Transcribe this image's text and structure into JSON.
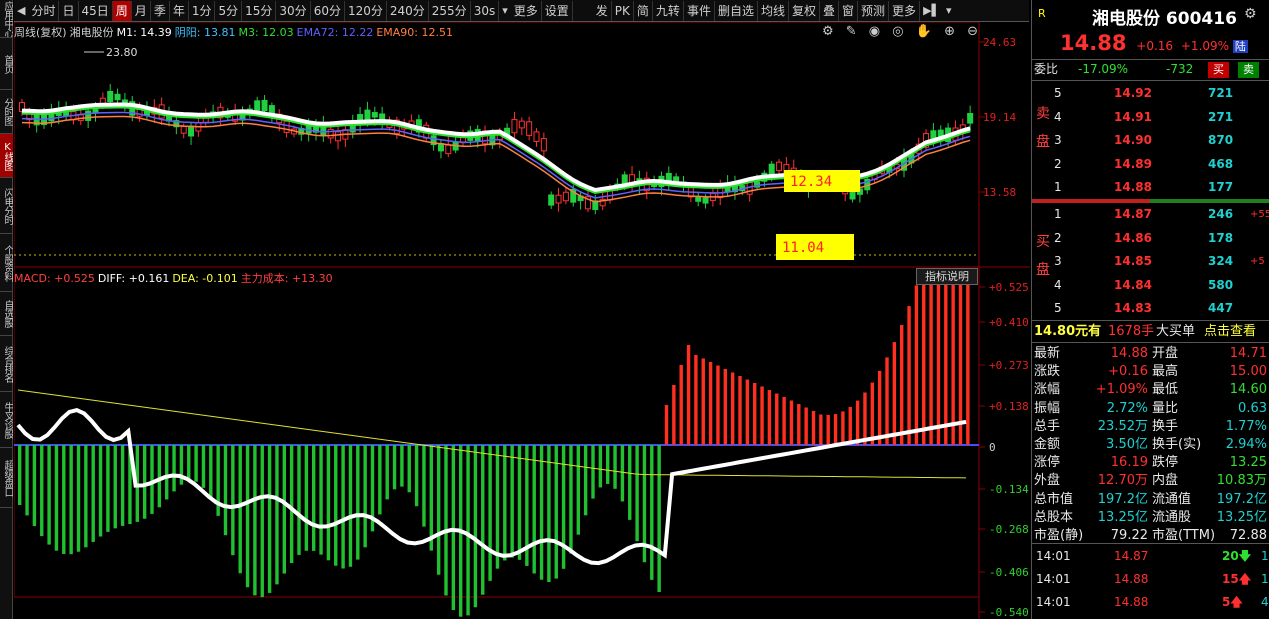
{
  "sidebar": {
    "items": [
      "应用中心",
      "首页",
      "分时图",
      "K线图",
      "闪电分时",
      "个股资料",
      "自选股",
      "综合排名",
      "牛叉诊股",
      "超级盘口"
    ],
    "active_index": 3
  },
  "toolbar": {
    "periods": [
      "分时",
      "日",
      "45日",
      "周",
      "月",
      "季",
      "年",
      "1分",
      "5分",
      "15分",
      "30分",
      "60分",
      "120分",
      "240分",
      "255分",
      "30s"
    ],
    "active_period": "周",
    "more_label": "更多",
    "settings_label": "设置",
    "tools": [
      "发",
      "PK",
      "简",
      "九转",
      "事件",
      "删自选",
      "均线",
      "复权",
      "叠",
      "窗",
      "预测",
      "更多"
    ]
  },
  "main_chart": {
    "legend": [
      {
        "text": "周线(复权)",
        "color": "#d0d0d0"
      },
      {
        "text": "湘电股份",
        "color": "#d0d0d0"
      },
      {
        "text": "M1: 14.39",
        "color": "#ffffff"
      },
      {
        "text": "阴阳: 13.81",
        "color": "#40c0ff"
      },
      {
        "text": "M3: 12.03",
        "color": "#30e030"
      },
      {
        "text": "EMA72: 12.22",
        "color": "#6060ff"
      },
      {
        "text": "EMA90: 12.51",
        "color": "#ff8040"
      }
    ],
    "y_labels": [
      "24.63",
      "19.14",
      "13.58"
    ],
    "high_label": "23.80",
    "box_high": "12.34",
    "box_low": "11.04"
  },
  "macd_chart": {
    "legend": [
      {
        "text": "MACD: +0.525",
        "color": "#ff4040"
      },
      {
        "text": "DIFF: +0.161",
        "color": "#ffffff"
      },
      {
        "text": "DEA: -0.101",
        "color": "#ffff40"
      },
      {
        "text": "主力成本: +13.30",
        "color": "#ff4040"
      }
    ],
    "indicator_btn": "指标说明",
    "y_labels": [
      "+0.525",
      "+0.410",
      "+0.273",
      "+0.138",
      "0",
      "-0.134",
      "-0.268",
      "-0.406",
      "-0.540"
    ]
  },
  "quote": {
    "mark": "R",
    "name": "湘电股份",
    "code": "600416",
    "price": "14.88",
    "change": "+0.16",
    "pct": "+1.09%",
    "tag": "陆",
    "webi_label": "委比",
    "webi": "-17.09%",
    "weicha": "-732",
    "buy_btn": "买",
    "sell_btn": "卖",
    "sell_label": "卖盘",
    "buy_label": "买盘",
    "asks": [
      {
        "lvl": "5",
        "price": "14.92",
        "vol": "721",
        "chg": ""
      },
      {
        "lvl": "4",
        "price": "14.91",
        "vol": "271",
        "chg": ""
      },
      {
        "lvl": "3",
        "price": "14.90",
        "vol": "870",
        "chg": ""
      },
      {
        "lvl": "2",
        "price": "14.89",
        "vol": "468",
        "chg": ""
      },
      {
        "lvl": "1",
        "price": "14.88",
        "vol": "177",
        "chg": ""
      }
    ],
    "bids": [
      {
        "lvl": "1",
        "price": "14.87",
        "vol": "246",
        "chg": "+55"
      },
      {
        "lvl": "2",
        "price": "14.86",
        "vol": "178",
        "chg": ""
      },
      {
        "lvl": "3",
        "price": "14.85",
        "vol": "324",
        "chg": "+5"
      },
      {
        "lvl": "4",
        "price": "14.84",
        "vol": "580",
        "chg": ""
      },
      {
        "lvl": "5",
        "price": "14.83",
        "vol": "447",
        "chg": ""
      }
    ],
    "bigorder": {
      "price": "14.80元有",
      "vol": "1678手",
      "text": "大买单",
      "link": "点击查看"
    },
    "stats": [
      {
        "l1": "最新",
        "v1": "14.88",
        "c1": "red",
        "l2": "开盘",
        "v2": "14.71",
        "c2": "red"
      },
      {
        "l1": "涨跌",
        "v1": "+0.16",
        "c1": "red",
        "l2": "最高",
        "v2": "15.00",
        "c2": "red"
      },
      {
        "l1": "涨幅",
        "v1": "+1.09%",
        "c1": "red",
        "l2": "最低",
        "v2": "14.60",
        "c2": "green"
      },
      {
        "l1": "振幅",
        "v1": "2.72%",
        "c1": "cyan",
        "l2": "量比",
        "v2": "0.63",
        "c2": "cyan"
      },
      {
        "l1": "总手",
        "v1": "23.52万",
        "c1": "cyan",
        "l2": "换手",
        "v2": "1.77%",
        "c2": "cyan"
      },
      {
        "l1": "金额",
        "v1": "3.50亿",
        "c1": "cyan",
        "l2": "换手(实)",
        "v2": "2.94%",
        "c2": "cyan"
      },
      {
        "l1": "涨停",
        "v1": "16.19",
        "c1": "red",
        "l2": "跌停",
        "v2": "13.25",
        "c2": "green"
      },
      {
        "l1": "外盘",
        "v1": "12.70万",
        "c1": "red",
        "l2": "内盘",
        "v2": "10.83万",
        "c2": "green"
      },
      {
        "l1": "总市值",
        "v1": "197.2亿",
        "c1": "cyan",
        "l2": "流通值",
        "v2": "197.2亿",
        "c2": "cyan"
      },
      {
        "l1": "总股本",
        "v1": "13.25亿",
        "c1": "cyan",
        "l2": "流通股",
        "v2": "13.25亿",
        "c2": "cyan"
      },
      {
        "l1": "市盈(静)",
        "v1": "79.22",
        "c1": "white",
        "l2": "市盈(TTM)",
        "v2": "72.88",
        "c2": "white"
      }
    ],
    "ticks": [
      {
        "time": "14:01",
        "price": "14.87",
        "vol": "20",
        "dir": "down",
        "n": "1"
      },
      {
        "time": "14:01",
        "price": "14.88",
        "vol": "15",
        "dir": "up",
        "n": "1"
      },
      {
        "time": "14:01",
        "price": "14.88",
        "vol": "5",
        "dir": "up",
        "n": "4"
      }
    ]
  }
}
